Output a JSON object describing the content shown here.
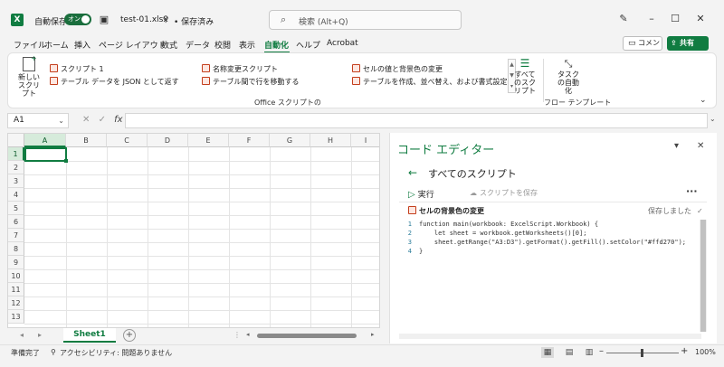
{
  "titlebar": {
    "autosave_label": "自動保存",
    "autosave_state": "オン",
    "filename": "test-01.xlsx",
    "save_status": "• 保存済み",
    "search_placeholder": "検索 (Alt+Q)"
  },
  "menu": {
    "tabs": [
      "ファイル",
      "ホーム",
      "挿入",
      "ページ レイアウト",
      "数式",
      "データ",
      "校閲",
      "表示",
      "自動化",
      "ヘルプ",
      "Acrobat"
    ],
    "active_tab": "自動化",
    "comment_label": "コメント",
    "share_label": "共有"
  },
  "ribbon": {
    "new_script": "新しいスクリプト",
    "scripts": [
      "スクリプト 1",
      "テーブル データを JSON として返す",
      "名称変更スクリプト",
      "テーブル間で行を移動する",
      "セルの値と背景色の変更",
      "テーブルを作成、並べ替え、および書式設定"
    ],
    "all_scripts": "すべてのスクリプト",
    "flow_label": "タスクの自動化",
    "group_office_scripts": "Office スクリプトの",
    "group_flow_templates": "フロー テンプレート"
  },
  "formula_bar": {
    "name_box": "A1",
    "fx_label": "fx",
    "value": ""
  },
  "grid": {
    "columns": [
      "A",
      "B",
      "C",
      "D",
      "E",
      "F",
      "G",
      "H",
      "I"
    ],
    "rows": [
      "1",
      "2",
      "3",
      "4",
      "5",
      "6",
      "7",
      "8",
      "9",
      "10",
      "11",
      "12",
      "13"
    ],
    "active_cell": "A1"
  },
  "sheets": {
    "tabs": [
      "Sheet1"
    ],
    "add_label": "+"
  },
  "editor": {
    "title": "コード エディター",
    "back_label": "すべてのスクリプト",
    "run_label": "実行",
    "save_label": "スクリプトを保存",
    "script_name": "セルの背景色の変更",
    "saved_status": "保存しました",
    "code_lines": [
      "function main(workbook: ExcelScript.Workbook) {",
      "    let sheet = workbook.getWorksheets()[0];",
      "    sheet.getRange(\"A3:D3\").getFormat().getFill().setColor(\"#ffd270\");",
      "}"
    ]
  },
  "statusbar": {
    "ready": "準備完了",
    "accessibility": "アクセシビリティ: 問題ありません",
    "zoom": "100%"
  },
  "colors": {
    "accent": "#107c41"
  }
}
